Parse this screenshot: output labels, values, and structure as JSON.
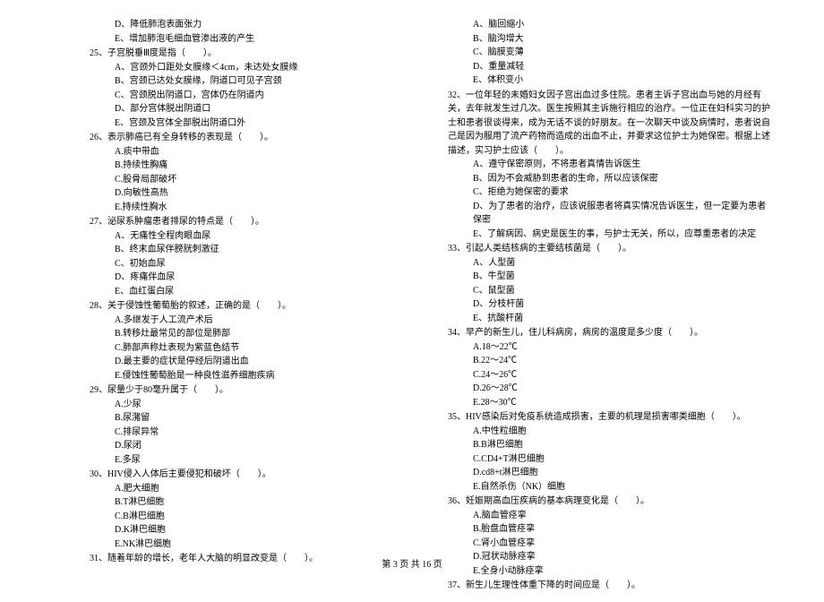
{
  "footer": "第 3 页 共 16 页",
  "left": {
    "pre": [
      "D、降低肺泡表面张力",
      "E、增加肺泡毛细血管渗出液的产生"
    ],
    "q25": {
      "stem": "25、子宫脱垂Ⅲ度是指（　　）。",
      "opts": [
        "A、宫颈外口距处女膜缘＜4cm，未达处女膜缘",
        "B、宫颈已达处女膜缘，阴道口可见子宫颈",
        "C、宫颈脱出阴道口，宫体仍在阴道内",
        "D、部分宫体脱出阴道口",
        "E、宫颈及宫体全部脱出阴道口外"
      ]
    },
    "q26": {
      "stem": "26、表示肺癌已有全身转移的表现是（　　）。",
      "opts": [
        "A.痰中带血",
        "B.持续性胸痛",
        "C.股骨局部破坏",
        "D.向敏性高热",
        "E.持续性胸水"
      ]
    },
    "q27": {
      "stem": "27、泌尿系肿瘤患者排尿的特点是（　　）。",
      "opts": [
        "A、无痛性全程肉眼血尿",
        "B、终末血尿伴膀胱刺激征",
        "C、初始血尿",
        "D、疼痛伴血尿",
        "E、血红蛋白尿"
      ]
    },
    "q28": {
      "stem": "28、关于侵蚀性葡萄胎的叙述，正确的是（　　）。",
      "opts": [
        "A.多继发于人工流产术后",
        "B.转移灶最常见的部位是肺部",
        "C.肺部声称灶表现为紫蓝色结节",
        "D.最主要的症状是停经后阴道出血",
        "E.侵蚀性葡萄胎是一种良性滋养细胞疾病"
      ]
    },
    "q29": {
      "stem": "29、尿量少于80毫升属于（　　）。",
      "opts": [
        "A.少尿",
        "B.尿潴留",
        "C.排尿异常",
        "D.尿闭",
        "E.多尿"
      ]
    },
    "q30": {
      "stem": "30、HIV侵入人体后主要侵犯和破坏（　　）。",
      "opts": [
        "A.肥大细胞",
        "B.T淋巴细胞",
        "C.B淋巴细胞",
        "D.K淋巴细胞",
        "E.NK淋巴细胞"
      ]
    },
    "q31": {
      "stem": "31、随着年龄的增长，老年人大脑的明显改变是（　　）。"
    }
  },
  "right": {
    "q31opts": [
      "A、脑回缩小",
      "B、脑沟增大",
      "C、脑膜变薄",
      "D、重量减轻",
      "E、体积变小"
    ],
    "q32": {
      "stem": "32、一位年轻的未婚妇女因子宫出血过多住院。患者主诉子宫出血与她的月经有关，去年就发生过几次。医生按照其主诉施行相应的治疗。一位正在妇科实习的护士和患者很谈得来，成为无话不谈的好朋友。在一次聊天中谈及病情时，患者说自己是因为服用了流产药物而造成的出血不止，并要求这位护士为她保密。根据上述描述，实习护士应该（　　）。",
      "opts": [
        "A、遵守保密原则，不将患者真情告诉医生",
        "B、因为不会威胁到患者的生命，所以应该保密",
        "C、拒绝为她保密的要求",
        "D、为了患者的治疗，应该说服患者将真实情况告诉医生，但一定要为患者保密",
        "E、了解病因、病史是医生的事，与护士无关，所以，应尊重患者的决定"
      ]
    },
    "q33": {
      "stem": "33、引起人类结核病的主要结核菌是（　　）。",
      "opts": [
        "A、人型菌",
        "B、牛型菌",
        "C、鼠型菌",
        "D、分枝杆菌",
        "E、抗酸杆菌"
      ]
    },
    "q34": {
      "stem": "34、早产的新生儿，住儿科病房，病房的温度是多少度（　　）。",
      "opts": [
        "A.18～22℃",
        "B.22～24℃",
        "C.24～26℃",
        "D.26～28℃",
        "E.28～30℃"
      ]
    },
    "q35": {
      "stem": "35、HIV感染后对免疫系统造成损害，主要的机理是损害哪类细胞（　　）。",
      "opts": [
        "A.中性粒细胞",
        "B.B淋巴细胞",
        "C.CD4+T淋巴细胞",
        "D.cd8+t淋巴细胞",
        "E.自然杀伤（NK）细胞"
      ]
    },
    "q36": {
      "stem": "36、妊娠期高血压疾病的基本病理变化是（　　）。",
      "opts": [
        "A.脑血管痉挛",
        "B.胎盘血管痉挛",
        "C.肾小血管痉挛",
        "D.冠状动脉痉挛",
        "E.全身小动脉痉挛"
      ]
    },
    "q37": {
      "stem": "37、新生儿生理性体重下降的时间应是（　　）。"
    }
  }
}
